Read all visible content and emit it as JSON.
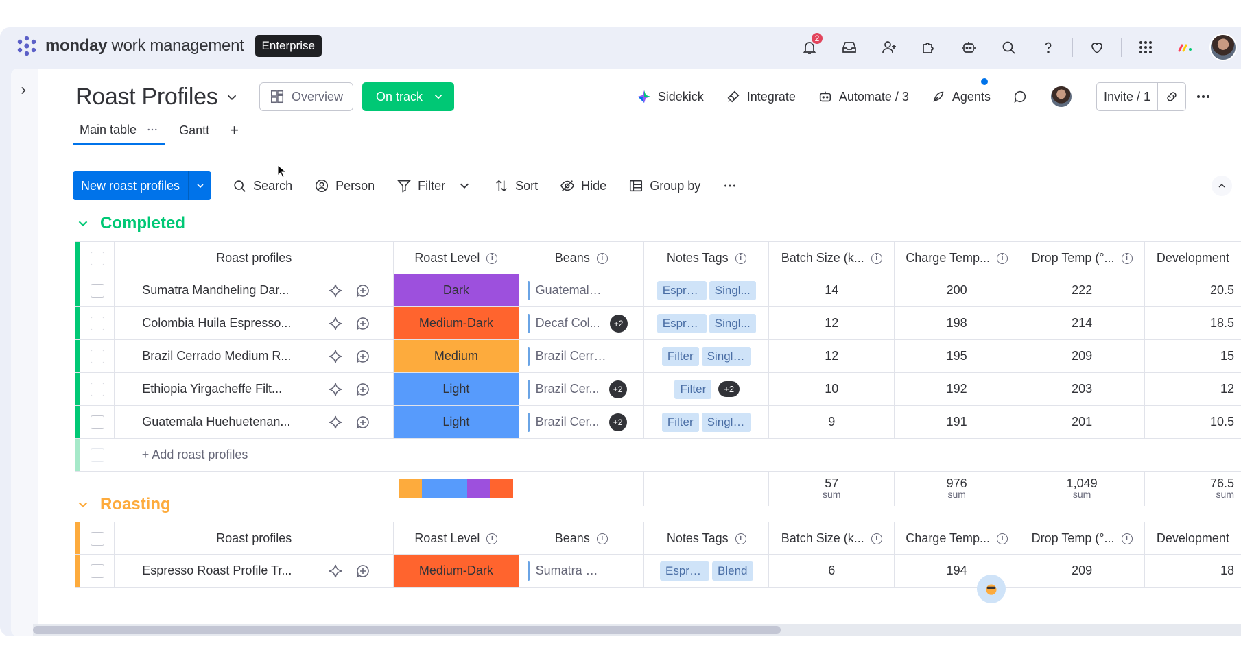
{
  "app": {
    "brand_bold": "monday",
    "brand_rest": "work management",
    "plan": "Enterprise",
    "notification_count": "2"
  },
  "board": {
    "title": "Roast Profiles",
    "overview_label": "Overview",
    "status_label": "On track",
    "sidekick": "Sidekick",
    "integrate": "Integrate",
    "automate": "Automate / 3",
    "agents": "Agents",
    "invite": "Invite / 1"
  },
  "views": {
    "main_table": "Main table",
    "gantt": "Gantt",
    "add": "+"
  },
  "toolbar": {
    "new_item": "New roast profiles",
    "search": "Search",
    "person": "Person",
    "filter": "Filter",
    "sort": "Sort",
    "hide": "Hide",
    "group_by": "Group by"
  },
  "columns": {
    "name": "Roast profiles",
    "roast_level": "Roast Level",
    "beans": "Beans",
    "notes_tags": "Notes Tags",
    "batch_size": "Batch Size (k...",
    "charge_temp": "Charge Temp...",
    "drop_temp": "Drop Temp (°...",
    "development": "Development"
  },
  "colors": {
    "completed": "#00c875",
    "roasting": "#fdab3d",
    "dark": "#9d50dd",
    "medium_dark": "#ff642e",
    "medium": "#fdab3d",
    "light": "#579bfc"
  },
  "groups": {
    "completed": {
      "title": "Completed",
      "add_label": "+ Add roast profiles",
      "rows": [
        {
          "name": "Sumatra Mandheling Dar...",
          "level": "Dark",
          "level_color": "#9d50dd",
          "beans": "Guatemala Hu...",
          "beans_more": "",
          "tag1": "Espre...",
          "tag2": "Singl...",
          "tag_more": "",
          "batch": "14",
          "charge": "200",
          "drop": "222",
          "dev": "20.5"
        },
        {
          "name": "Colombia Huila Espresso...",
          "level": "Medium-Dark",
          "level_color": "#ff642e",
          "beans": "Decaf Col...",
          "beans_more": "+2",
          "tag1": "Espre...",
          "tag2": "Singl...",
          "tag_more": "",
          "batch": "12",
          "charge": "198",
          "drop": "214",
          "dev": "18.5"
        },
        {
          "name": "Brazil Cerrado Medium R...",
          "level": "Medium",
          "level_color": "#fdab3d",
          "beans": "Brazil Cerrado ...",
          "beans_more": "",
          "tag1": "Filter",
          "tag2": "Single ...",
          "tag_more": "",
          "batch": "12",
          "charge": "195",
          "drop": "209",
          "dev": "15"
        },
        {
          "name": "Ethiopia Yirgacheffe Filt...",
          "level": "Light",
          "level_color": "#579bfc",
          "beans": "Brazil Cer...",
          "beans_more": "+2",
          "tag1": "Filter",
          "tag2": "",
          "tag_more": "+2",
          "batch": "10",
          "charge": "192",
          "drop": "203",
          "dev": "12"
        },
        {
          "name": "Guatemala Huehuetenan...",
          "level": "Light",
          "level_color": "#579bfc",
          "beans": "Brazil Cer...",
          "beans_more": "+2",
          "tag1": "Filter",
          "tag2": "Single ...",
          "tag_more": "",
          "batch": "9",
          "charge": "191",
          "drop": "201",
          "dev": "10.5"
        }
      ],
      "summary": {
        "level_distribution": [
          {
            "color": "#fdab3d",
            "fraction": 0.2
          },
          {
            "color": "#579bfc",
            "fraction": 0.4
          },
          {
            "color": "#9d50dd",
            "fraction": 0.2
          },
          {
            "color": "#ff642e",
            "fraction": 0.2
          }
        ],
        "batch_sum": "57",
        "charge_sum": "976",
        "drop_sum": "1,049",
        "dev_sum": "76.5",
        "sum_label": "sum"
      }
    },
    "roasting": {
      "title": "Roasting",
      "rows": [
        {
          "name": "Espresso Roast Profile Tr...",
          "level": "Medium-Dark",
          "level_color": "#ff642e",
          "beans": "Sumatra Mand...",
          "tag1": "Espres...",
          "tag2": "Blend",
          "batch": "6",
          "charge": "194",
          "drop": "209",
          "dev": "18"
        }
      ]
    }
  }
}
